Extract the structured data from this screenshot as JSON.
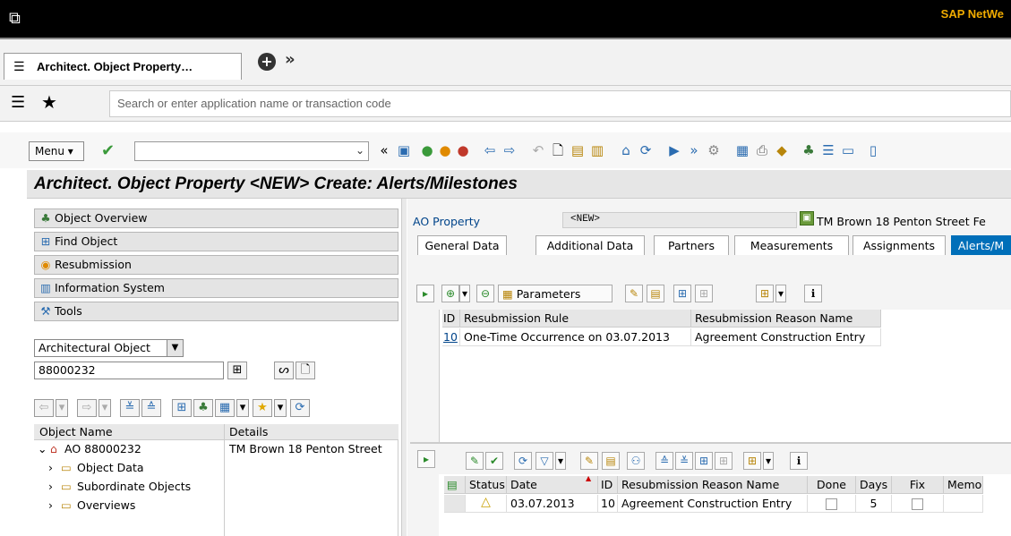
{
  "window": {
    "brand": "SAP NetWe"
  },
  "tab": {
    "label": "Architect. Object Property…"
  },
  "search": {
    "placeholder": "Search or enter application name or transaction code"
  },
  "toolbar": {
    "menu_label": "Menu"
  },
  "page": {
    "title": "Architect. Object Property <NEW> Create: Alerts/Milestones"
  },
  "nav": {
    "items": [
      {
        "label": "Object Overview",
        "icon": "object-overview-icon"
      },
      {
        "label": "Find Object",
        "icon": "binoculars-icon"
      },
      {
        "label": "Resubmission",
        "icon": "resubmission-icon"
      },
      {
        "label": "Information System",
        "icon": "information-system-icon"
      },
      {
        "label": "Tools",
        "icon": "tools-icon"
      }
    ]
  },
  "objsearch": {
    "type_value": "Architectural Object",
    "number_value": "88000232"
  },
  "tree": {
    "col_object": "Object Name",
    "col_details": "Details",
    "root": {
      "name": "AO 88000232",
      "details": "TM Brown 18 Penton Street"
    },
    "children": [
      "Object Data",
      "Subordinate Objects",
      "Overviews"
    ]
  },
  "header": {
    "ao_label": "AO Property",
    "ao_value": "<NEW>",
    "ao_desc": "TM Brown 18 Penton Street Fe"
  },
  "tabs": [
    "General Data",
    "Additional Data",
    "Partners",
    "Measurements",
    "Assignments",
    "Alerts/M"
  ],
  "grid1": {
    "params_label": "Parameters",
    "headers": [
      "ID",
      "Resubmission Rule",
      "Resubmission Reason Name"
    ],
    "rows": [
      {
        "id": "10",
        "rule": "One-Time Occurrence on 03.07.2013",
        "reason": "Agreement Construction Entry"
      }
    ]
  },
  "grid2": {
    "headers": [
      "Status",
      "Date",
      "ID",
      "Resubmission Reason Name",
      "Done",
      "Days",
      "Fix",
      "Memo"
    ],
    "rows": [
      {
        "date": "03.07.2013",
        "id": "10",
        "reason": "Agreement Construction Entry",
        "days": "5"
      }
    ]
  }
}
